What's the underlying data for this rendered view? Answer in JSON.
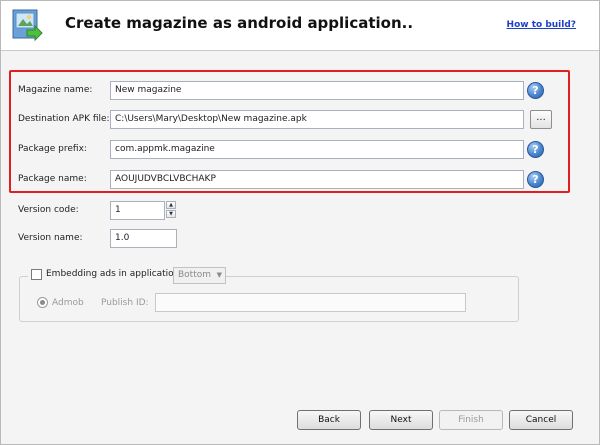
{
  "header": {
    "title": "Create magazine as android application..",
    "help_link": "How to build?",
    "icon": "android-app-icon"
  },
  "form": {
    "magazine_name": {
      "label": "Magazine name:",
      "value": "New magazine"
    },
    "destination_apk": {
      "label": "Destination APK file:",
      "value": "C:\\Users\\Mary\\Desktop\\New magazine.apk",
      "browse_label": "..."
    },
    "package_prefix": {
      "label": "Package prefix:",
      "value": "com.appmk.magazine"
    },
    "package_name": {
      "label": "Package name:",
      "value": "AOUJUDVBCLVBCHAKP"
    },
    "version_code": {
      "label": "Version code:",
      "value": "1"
    },
    "version_name": {
      "label": "Version name:",
      "value": "1.0"
    },
    "help_glyph": "?"
  },
  "ads": {
    "checkbox_label": "Embedding ads in application",
    "position_select": "Bottom",
    "provider_label": "Admob",
    "publish_id_label": "Publish ID:",
    "publish_id_value": ""
  },
  "buttons": {
    "back": "Back",
    "next": "Next",
    "finish": "Finish",
    "cancel": "Cancel"
  },
  "colors": {
    "highlight": "#e02020",
    "link": "#1f3fc8",
    "help_icon": "#4a86cf"
  }
}
